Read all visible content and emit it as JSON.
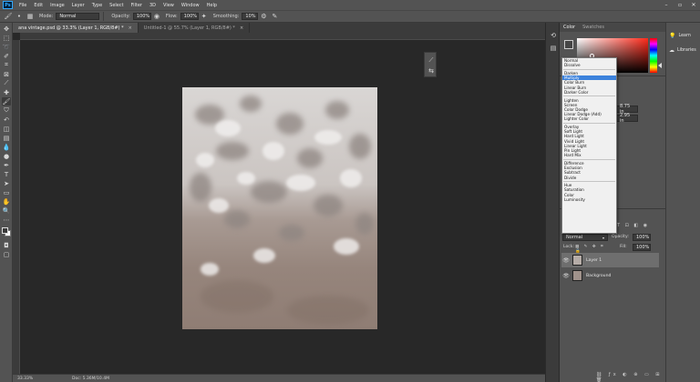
{
  "menubar": {
    "items": [
      "File",
      "Edit",
      "Image",
      "Layer",
      "Type",
      "Select",
      "Filter",
      "3D",
      "View",
      "Window",
      "Help"
    ],
    "logo": "Ps"
  },
  "options": {
    "mode_label": "Mode:",
    "mode_value": "Normal",
    "opacity_label": "Opacity:",
    "opacity_value": "100%",
    "flow_label": "Flow:",
    "flow_value": "100%",
    "smoothing_label": "Smoothing:",
    "smoothing_value": "10%"
  },
  "tabs": [
    {
      "label": "ana vintage.psd @ 33.3% (Layer 1, RGB/8#) *",
      "active": true
    },
    {
      "label": "Untitled-1 @ 55.7% (Layer 1, RGB/8#) *",
      "active": false
    }
  ],
  "status": {
    "zoom": "33.33%",
    "doc": "Doc: 5.36M/10.4M"
  },
  "color_panel": {
    "tab_color": "Color",
    "tab_swatches": "Swatches"
  },
  "properties": {
    "width_value": "8.75 in",
    "height_value": "2.95 in"
  },
  "blend_menu": {
    "groups": [
      [
        "Normal",
        "Dissolve"
      ],
      [
        "Darken",
        "Multiply",
        "Color Burn",
        "Linear Burn",
        "Darker Color"
      ],
      [
        "Lighten",
        "Screen",
        "Color Dodge",
        "Linear Dodge (Add)",
        "Lighter Color"
      ],
      [
        "Overlay",
        "Soft Light",
        "Hard Light",
        "Vivid Light",
        "Linear Light",
        "Pin Light",
        "Hard Mix"
      ],
      [
        "Difference",
        "Exclusion",
        "Subtract",
        "Divide"
      ],
      [
        "Hue",
        "Saturation",
        "Color",
        "Luminosity"
      ]
    ],
    "selected": "Multiply"
  },
  "layers_panel": {
    "blend_value": "Normal",
    "opacity_label": "Opacity:",
    "opacity_value": "100%",
    "lock_label": "Lock:",
    "fill_label": "Fill:",
    "fill_value": "100%",
    "layers": [
      {
        "name": "Layer 1",
        "selected": true
      },
      {
        "name": "Background",
        "selected": false
      }
    ]
  },
  "learn_panel": {
    "learn_label": "Learn",
    "libraries_label": "Libraries"
  },
  "colors": {
    "accent": "#3c82dc",
    "ui_gray": "#535353",
    "canvas_bg": "#282828"
  }
}
